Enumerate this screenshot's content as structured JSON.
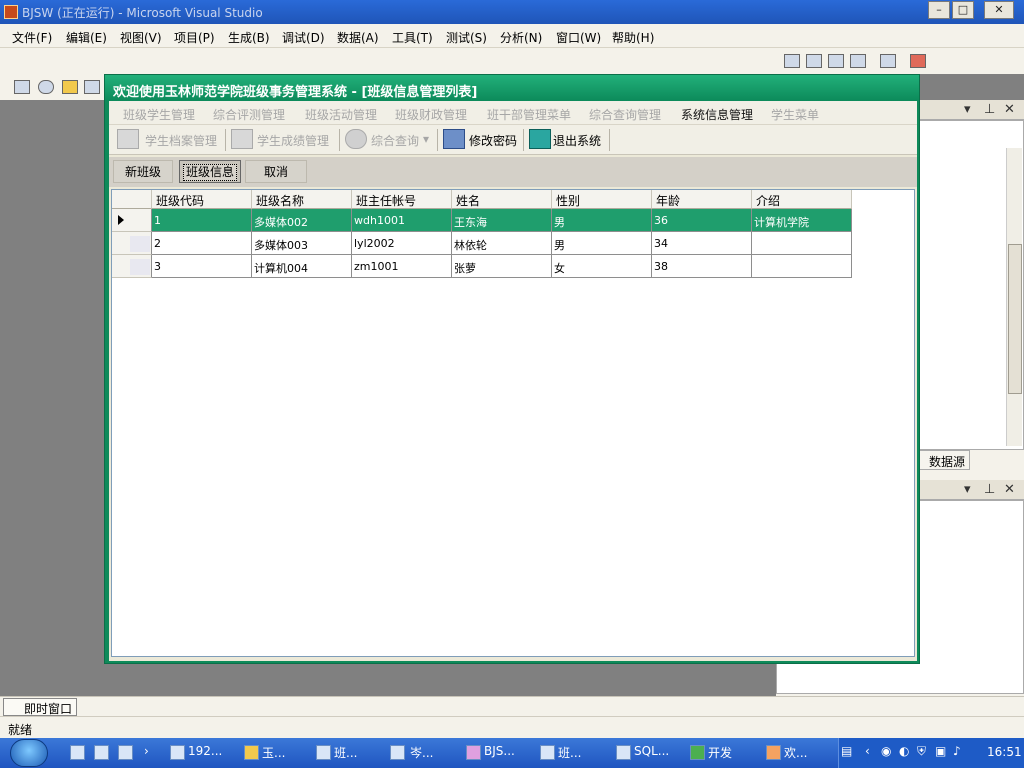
{
  "vs": {
    "title": "BJSW (正在运行) - Microsoft Visual Studio",
    "window_buttons": [
      "–",
      "□",
      "✕"
    ],
    "menu": [
      "文件(F)",
      "编辑(E)",
      "视图(V)",
      "项目(P)",
      "生成(B)",
      "调试(D)",
      "数据(A)",
      "工具(T)",
      "测试(S)",
      "分析(N)",
      "窗口(W)",
      "帮助(H)"
    ],
    "datasource_tab": "数据源",
    "immediate_tab": "即时窗口",
    "status": "就绪"
  },
  "app": {
    "title": "欢迎使用玉林师范学院班级事务管理系统 - [班级信息管理列表]",
    "modules": [
      "班级学生管理",
      "综合评测管理",
      "班级活动管理",
      "班级财政管理",
      "班干部管理菜单",
      "综合查询管理",
      "系统信息管理",
      "学生菜单"
    ],
    "active_module": "系统信息管理",
    "toolbar": {
      "student_files": "学生档案管理",
      "student_scores": "学生成绩管理",
      "combined_query": "综合查询",
      "change_password": "修改密码",
      "exit": "退出系统"
    },
    "actions": {
      "new_class": "新班级",
      "class_info": "班级信息",
      "cancel": "取消"
    },
    "grid": {
      "columns": [
        "班级代码",
        "班级名称",
        "班主任帐号",
        "姓名",
        "性别",
        "年龄",
        "介绍"
      ],
      "rows": [
        [
          "1",
          "多媒体002",
          "wdh1001",
          "王东海",
          "男",
          "36",
          "计算机学院"
        ],
        [
          "2",
          "多媒体003",
          "lyl2002",
          "林依轮",
          "男",
          "34",
          ""
        ],
        [
          "3",
          "计算机004",
          "zm1001",
          "张萝",
          "女",
          "38",
          ""
        ]
      ],
      "selected_row": 0
    }
  },
  "taskbar": {
    "items": [
      "192...",
      "玉...",
      "班...",
      "岑...",
      "BJS...",
      "班...",
      "SQL...",
      "开发",
      "欢..."
    ],
    "clock": "16:51"
  }
}
